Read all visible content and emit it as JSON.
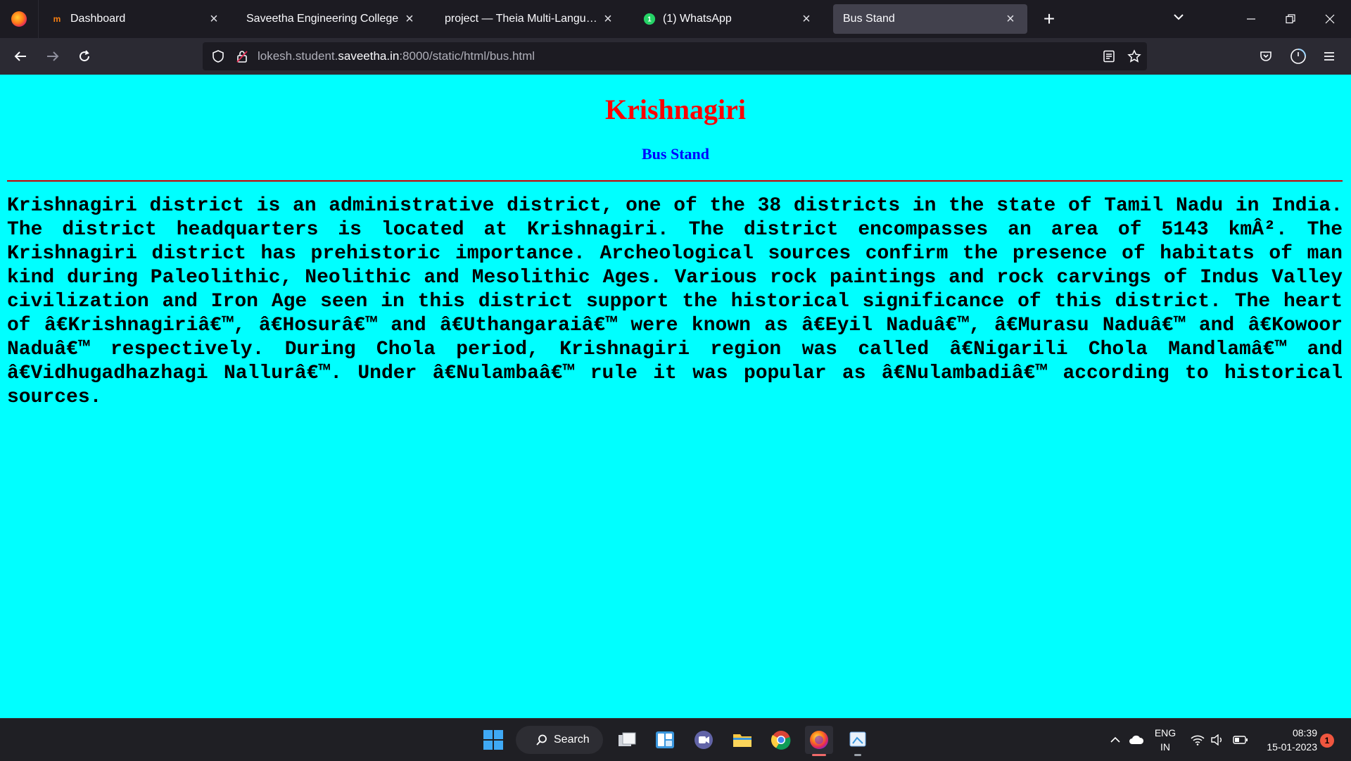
{
  "browser": {
    "tabs": [
      {
        "label": "Dashboard",
        "favicon": "moodle-icon",
        "active": false
      },
      {
        "label": "Saveetha Engineering College",
        "favicon": "none",
        "active": false
      },
      {
        "label": "project — Theia Multi-Language Ex",
        "favicon": "none",
        "active": false
      },
      {
        "label": "(1) WhatsApp",
        "favicon": "whatsapp-icon",
        "active": false
      },
      {
        "label": "Bus Stand",
        "favicon": "none",
        "active": true
      }
    ],
    "url": {
      "prefix": "lokesh.student.",
      "domain": "saveetha.in",
      "suffix": ":8000/static/html/bus.html"
    }
  },
  "page": {
    "title": "Krishnagiri",
    "subtitle": "Bus Stand",
    "body": "Krishnagiri district is an administrative district, one of the 38 districts in the state of Tamil Nadu in India. The district headquarters is located at Krishnagiri. The district encompasses an area of 5143 kmÂ². The Krishnagiri district has prehistoric importance. Archeological sources confirm the presence of habitats of man kind during Paleolithic, Neolithic and Mesolithic Ages. Various rock paintings and rock carvings of Indus Valley civilization and Iron Age seen in this district support the historical significance of this district. The heart of â€Krishnagiriâ€™, â€Hosurâ€™ and â€Uthangaraiâ€™ were known as â€Eyil Naduâ€™, â€Murasu Naduâ€™ and â€Kowoor Naduâ€™ respectively. During Chola period, Krishnagiri region was called â€Nigarili Chola Mandlamâ€™ and â€Vidhugadhazhagi Nallurâ€™. Under â€Nulambaâ€™ rule it was popular as â€Nulambadiâ€™ according to historical sources.",
    "colors": {
      "background": "#00ffff",
      "title": "#ff0000",
      "subtitle": "#0000ff",
      "rule": "#cc0000"
    }
  },
  "taskbar": {
    "search_label": "Search",
    "lang_line1": "ENG",
    "lang_line2": "IN",
    "time": "08:39",
    "date": "15-01-2023",
    "notification_count": "1"
  }
}
